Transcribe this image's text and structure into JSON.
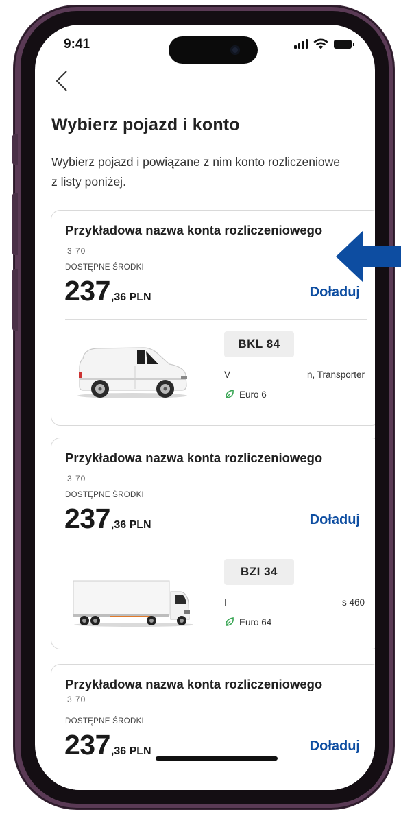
{
  "status_bar": {
    "time": "9:41",
    "icons": [
      "signal-icon",
      "wifi-icon",
      "battery-icon"
    ]
  },
  "header": {
    "back_icon": "chevron-left-icon",
    "title": "Wybierz pojazd i konto",
    "subtitle": "Wybierz pojazd i powiązane z nim konto rozliczeniowe z listy poniżej."
  },
  "accounts": [
    {
      "name": "Przykładowa nazwa konta rozliczeniowego",
      "number": "3  70",
      "funds_label": "DOSTĘPNE ŚRODKI",
      "balance_int": "237",
      "balance_dec": ",36 PLN",
      "topup_label": "Doładuj",
      "vehicle": {
        "type_icon": "van-icon",
        "plate": "BKL   84",
        "model_left": "V",
        "model_right": "n, Transporter",
        "emission": "Euro 6"
      }
    },
    {
      "name": "Przykładowa nazwa konta rozliczeniowego",
      "number": "3  70",
      "funds_label": "DOSTĘPNE ŚRODKI",
      "balance_int": "237",
      "balance_dec": ",36 PLN",
      "topup_label": "Doładuj",
      "vehicle": {
        "type_icon": "truck-icon",
        "plate": "BZI   34",
        "model_left": "I",
        "model_right": "s 460",
        "emission": "Euro 64"
      }
    },
    {
      "name": "Przykładowa nazwa konta rozliczeniowego",
      "number": "3  70",
      "funds_label": "DOSTĘPNE ŚRODKI",
      "balance_int": "237",
      "balance_dec": ",36 PLN",
      "topup_label": "Doładuj"
    }
  ],
  "colors": {
    "accent": "#0d4da1",
    "eco_green": "#3aa655",
    "arrow": "#0d4da1",
    "frame": "#5a3a55"
  }
}
